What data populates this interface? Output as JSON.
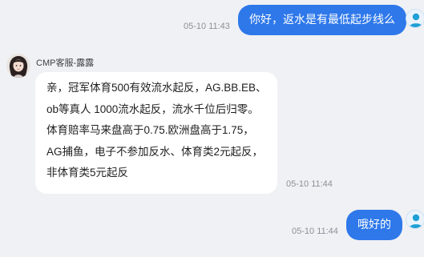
{
  "messages": [
    {
      "sender": "user",
      "time": "05-10 11:43",
      "text": "你好，返水是有最低起步线么"
    },
    {
      "sender": "agent",
      "agent_name": "CMP客服-露露",
      "time": "05-10 11:44",
      "lines": [
        "亲，冠军体育500有效流水起反，AG.BB.EB、",
        "ob等真人 1000流水起反，流水千位后归零。",
        "体育赔率马来盘高于0.75.欧洲盘高于1.75，",
        "AG捕鱼，电子不参加反水、体育类2元起反，",
        "非体育类5元起反"
      ]
    },
    {
      "sender": "user",
      "time": "05-10 11:44",
      "text": "哦好的"
    }
  ],
  "colors": {
    "background": "#f0f1f4",
    "user_bubble": "#2e78ea",
    "agent_bubble": "#ffffff",
    "timestamp": "#8c9099"
  },
  "icons": {
    "user_avatar": "user-silhouette-icon",
    "agent_avatar": "agent-portrait-avatar"
  }
}
